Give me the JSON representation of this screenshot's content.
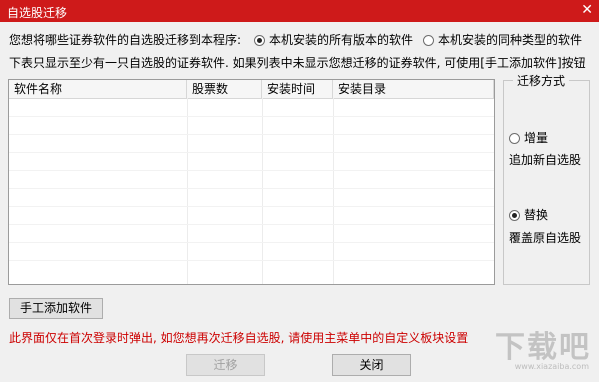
{
  "window": {
    "title": "自选股迁移",
    "close_glyph": "✕"
  },
  "question": {
    "label": "您想将哪些证券软件的自选股迁移到本程序:",
    "option_all": "本机安装的所有版本的软件",
    "option_same": "本机安装的同种类型的软件",
    "selected": "option_all"
  },
  "hint": "下表只显示至少有一只自选股的证券软件. 如果列表中未显示您想迁移的证券软件, 可使用[手工添加软件]按钮",
  "table": {
    "columns": [
      "软件名称",
      "股票数",
      "安装时间",
      "安装目录"
    ],
    "rows": []
  },
  "mode": {
    "legend": "迁移方式",
    "incremental_label": "增量",
    "incremental_desc": "追加新自选股",
    "replace_label": "替换",
    "replace_desc": "覆盖原自选股",
    "selected": "replace"
  },
  "buttons": {
    "manual_add": "手工添加软件",
    "migrate": "迁移",
    "close": "关闭"
  },
  "notice": "此界面仅在首次登录时弹出, 如您想再次迁移自选股, 请使用主菜单中的自定义板块设置",
  "watermark": {
    "main": "下载吧",
    "sub": "www.xiazaiba.com"
  }
}
